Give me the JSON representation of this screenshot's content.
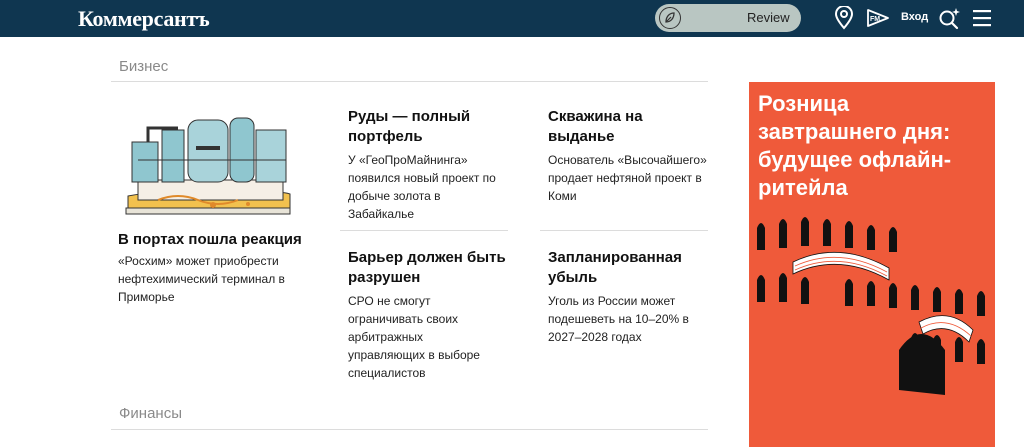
{
  "header": {
    "logo": "Коммерсантъ",
    "review_label": "Review",
    "login_label": "Вход",
    "icons": [
      "leaf-icon",
      "location-pin-icon",
      "fm-radio-icon",
      "search-sparkle-icon",
      "menu-icon"
    ]
  },
  "sections": {
    "business": "Бизнес",
    "finance": "Финансы"
  },
  "articles": [
    {
      "title": "В портах пошла реакция",
      "text": "«Росхим» может приобрести нефтехимический терминал в Приморье"
    },
    {
      "title": "Руды — полный портфель",
      "text": "У «ГеоПроМайнинга» появился новый проект по добыче золота в Забайкалье"
    },
    {
      "title": "Скважина на выданье",
      "text": "Основатель «Высочайшего» продает нефтяной проект в Коми"
    },
    {
      "title": "Барьер должен быть разрушен",
      "text": "СРО не смогут ограничивать своих арбитражных управляющих в выборе специалистов"
    },
    {
      "title": "Запланированная убыль",
      "text": "Уголь из России может подешеветь на 10–20% в 2027–2028 годах"
    }
  ],
  "ad": {
    "headline": "Розница завтрашнего дня: будущее офлайн-ритейла"
  },
  "colors": {
    "header_bg": "#0f3650",
    "ad_bg": "#ef5a3a",
    "review_pill": "#b9c6c2",
    "section_gray": "#8a8a8a"
  }
}
